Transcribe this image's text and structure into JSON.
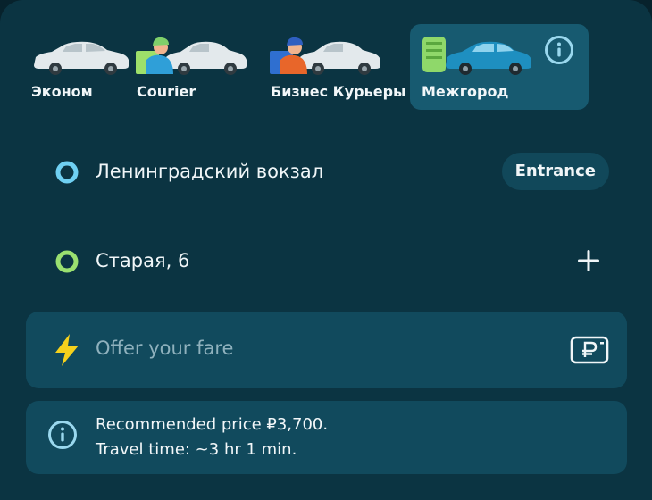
{
  "tariffs": [
    {
      "label": "Эконом",
      "icon": "sedan-car-icon",
      "selected": false
    },
    {
      "label": "Courier",
      "icon": "courier-car-icon",
      "selected": false
    },
    {
      "label": "Бизнес Курьеры",
      "icon": "business-courier-car-icon",
      "selected": false
    },
    {
      "label": "Межгород",
      "icon": "intercity-car-icon",
      "selected": true
    }
  ],
  "route": {
    "from": {
      "address": "Ленинградский вокзал",
      "action_label": "Entrance"
    },
    "to": {
      "address": "Старая, 6"
    }
  },
  "fare": {
    "placeholder": "Offer your fare"
  },
  "info": {
    "price_text": "Recommended price ₽3,700.",
    "time_text": "Travel time: ~3 hr 1 min."
  },
  "colors": {
    "background": "#0b3442",
    "card": "#114a5d",
    "selected_tariff": "#175a70",
    "pickup_dot": "#6fd0f2",
    "dropoff_dot": "#9ae070",
    "bolt": "#f5d11c"
  }
}
